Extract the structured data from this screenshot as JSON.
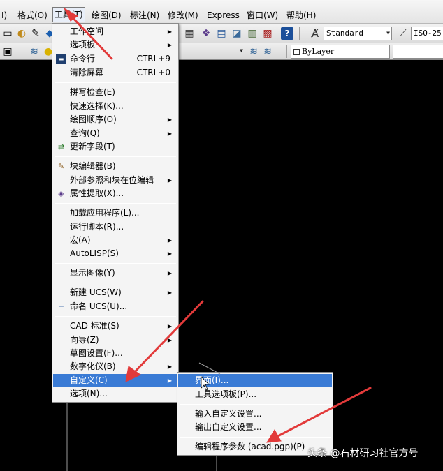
{
  "menubar": {
    "items": [
      "I)",
      "格式(O)",
      "工具(T)",
      "绘图(D)",
      "标注(N)",
      "修改(M)",
      "Express",
      "窗口(W)",
      "帮助(H)"
    ]
  },
  "toolbar": {
    "text_style": "Standard",
    "dim_style": "ISO-25",
    "layer_control": "ByLayer"
  },
  "tools_menu": {
    "items": [
      {
        "label": "工作空间",
        "shortcut": "",
        "submenu": true,
        "icon": ""
      },
      {
        "label": "选项板",
        "shortcut": "",
        "submenu": true,
        "icon": ""
      },
      {
        "label": "命令行",
        "shortcut": "CTRL+9",
        "submenu": false,
        "icon": "command-line-icon"
      },
      {
        "label": "清除屏幕",
        "shortcut": "CTRL+0",
        "submenu": false,
        "icon": ""
      },
      {
        "label": "拼写检查(E)",
        "shortcut": "",
        "submenu": false,
        "icon": ""
      },
      {
        "label": "快速选择(K)...",
        "shortcut": "",
        "submenu": false,
        "icon": ""
      },
      {
        "label": "绘图顺序(O)",
        "shortcut": "",
        "submenu": true,
        "icon": ""
      },
      {
        "label": "查询(Q)",
        "shortcut": "",
        "submenu": true,
        "icon": ""
      },
      {
        "label": "更新字段(T)",
        "shortcut": "",
        "submenu": false,
        "icon": "update-field-icon"
      },
      {
        "label": "块编辑器(B)",
        "shortcut": "",
        "submenu": false,
        "icon": "block-editor-icon"
      },
      {
        "label": "外部参照和块在位编辑",
        "shortcut": "",
        "submenu": true,
        "icon": ""
      },
      {
        "label": "属性提取(X)...",
        "shortcut": "",
        "submenu": false,
        "icon": "attribute-extract-icon"
      },
      {
        "label": "加载应用程序(L)...",
        "shortcut": "",
        "submenu": false,
        "icon": ""
      },
      {
        "label": "运行脚本(R)...",
        "shortcut": "",
        "submenu": false,
        "icon": ""
      },
      {
        "label": "宏(A)",
        "shortcut": "",
        "submenu": true,
        "icon": ""
      },
      {
        "label": "AutoLISP(S)",
        "shortcut": "",
        "submenu": true,
        "icon": ""
      },
      {
        "label": "显示图像(Y)",
        "shortcut": "",
        "submenu": true,
        "icon": ""
      },
      {
        "label": "新建 UCS(W)",
        "shortcut": "",
        "submenu": true,
        "icon": ""
      },
      {
        "label": "命名 UCS(U)...",
        "shortcut": "",
        "submenu": false,
        "icon": "named-ucs-icon"
      },
      {
        "label": "CAD 标准(S)",
        "shortcut": "",
        "submenu": true,
        "icon": ""
      },
      {
        "label": "向导(Z)",
        "shortcut": "",
        "submenu": true,
        "icon": ""
      },
      {
        "label": "草图设置(F)...",
        "shortcut": "",
        "submenu": false,
        "icon": ""
      },
      {
        "label": "数字化仪(B)",
        "shortcut": "",
        "submenu": true,
        "icon": ""
      },
      {
        "label": "自定义(C)",
        "shortcut": "",
        "submenu": true,
        "icon": ""
      },
      {
        "label": "选项(N)...",
        "shortcut": "",
        "submenu": false,
        "icon": ""
      }
    ]
  },
  "customize_submenu": {
    "items": [
      {
        "label": "界面(I)..."
      },
      {
        "label": "工具选项板(P)..."
      },
      {
        "label": "输入自定义设置..."
      },
      {
        "label": "输出自定义设置..."
      },
      {
        "label": "编辑程序参数 (acad.pgp)(P)"
      }
    ]
  },
  "watermark": "头条 @石材研习社官方号",
  "colors": {
    "highlight": "#3a7bd5",
    "arrow": "#e23a3a"
  }
}
